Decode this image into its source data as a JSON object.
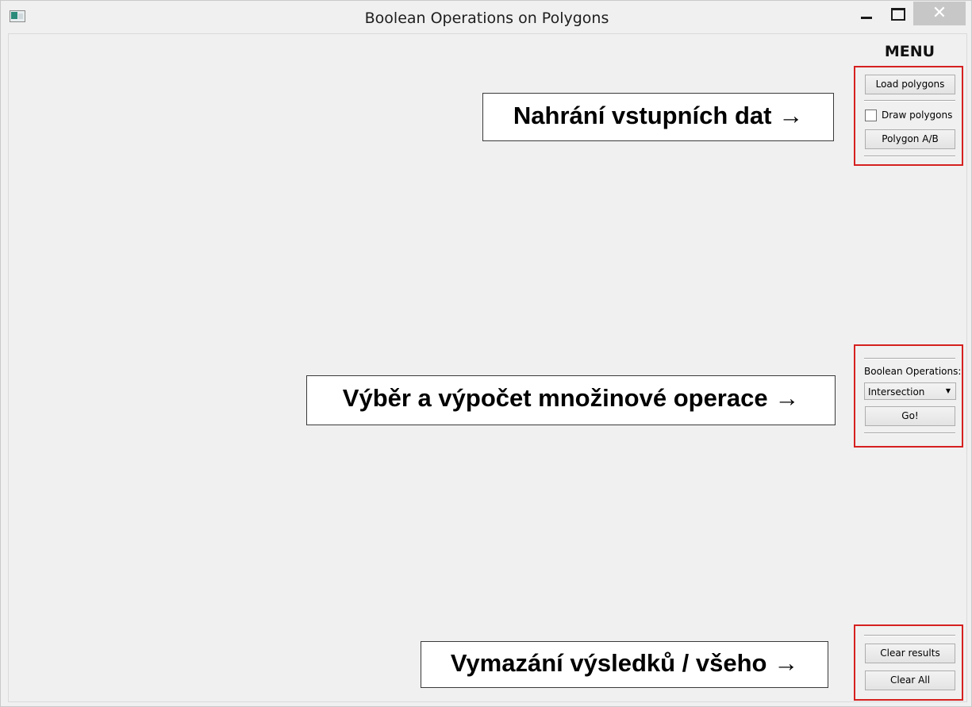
{
  "window": {
    "title": "Boolean Operations on Polygons",
    "close_glyph": "✕"
  },
  "menu": {
    "title": "MENU",
    "load_polygons": "Load polygons",
    "draw_polygons": "Draw polygons",
    "polygon_ab": "Polygon A/B",
    "boolean_ops_label": "Boolean Operations:",
    "operation_selected": "Intersection",
    "go": "Go!",
    "clear_results": "Clear results",
    "clear_all": "Clear All"
  },
  "annotations": {
    "load": "Nahrání vstupních dat →",
    "operation": "Výběr a výpočet množinové operace →",
    "clear": "Vymazání výsledků / všeho →"
  },
  "colors": {
    "highlight": "#d62020",
    "background": "#f0f0f0"
  },
  "icons": {
    "app": "app-icon",
    "minimize": "minimize-icon",
    "maximize": "maximize-icon",
    "close": "close-icon",
    "dropdown": "chevron-down-icon"
  }
}
